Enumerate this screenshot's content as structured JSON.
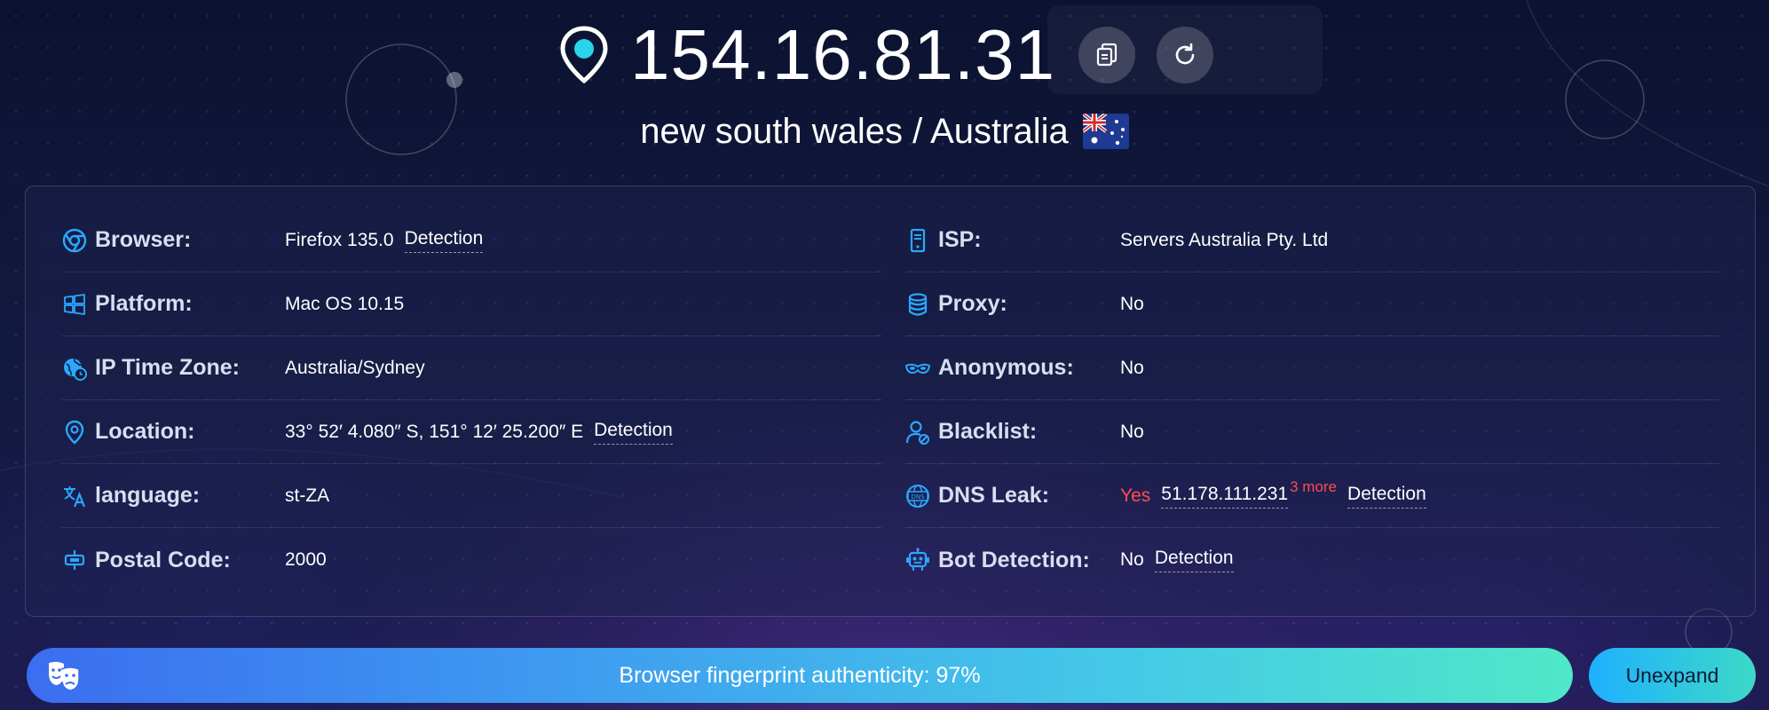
{
  "header": {
    "ip": "154.16.81.31",
    "region": "new south wales / Australia",
    "copy_button_icon": "copy-icon",
    "refresh_button_icon": "refresh-icon",
    "flag_icon": "australia-flag-icon"
  },
  "left_rows": [
    {
      "icon": "chrome-icon",
      "label": "Browser:",
      "value": "Firefox 135.0",
      "link": "Detection"
    },
    {
      "icon": "windows-icon",
      "label": "Platform:",
      "value": "Mac OS 10.15"
    },
    {
      "icon": "globe-clock-icon",
      "label": "IP Time Zone:",
      "value": "Australia/Sydney"
    },
    {
      "icon": "location-pin-icon",
      "label": "Location:",
      "value": "33° 52′ 4.080″ S, 151° 12′ 25.200″ E",
      "link": "Detection"
    },
    {
      "icon": "translate-icon",
      "label": "language:",
      "value": "st-ZA"
    },
    {
      "icon": "mailbox-icon",
      "label": "Postal Code:",
      "value": "2000"
    }
  ],
  "right_rows": [
    {
      "icon": "server-icon",
      "label": "ISP:",
      "value": "Servers Australia Pty. Ltd"
    },
    {
      "icon": "database-icon",
      "label": "Proxy:",
      "value": "No"
    },
    {
      "icon": "mask-icon",
      "label": "Anonymous:",
      "value": "No"
    },
    {
      "icon": "user-block-icon",
      "label": "Blacklist:",
      "value": "No"
    },
    {
      "icon": "dns-icon",
      "label": "DNS Leak:",
      "status": "Yes",
      "value": "51.178.111.231",
      "more": "3 more",
      "link": "Detection"
    },
    {
      "icon": "robot-icon",
      "label": "Bot Detection:",
      "value": "No",
      "link": "Detection"
    }
  ],
  "footer": {
    "fingerprint_text": "Browser fingerprint authenticity: 97%",
    "authenticity_percent": 97,
    "unexpand_label": "Unexpand",
    "fingerprint_icon": "theater-masks-icon"
  },
  "colors": {
    "accent_blue": "#2aa8ff",
    "warning_red": "#ff4d4d",
    "background": "#131a40"
  }
}
